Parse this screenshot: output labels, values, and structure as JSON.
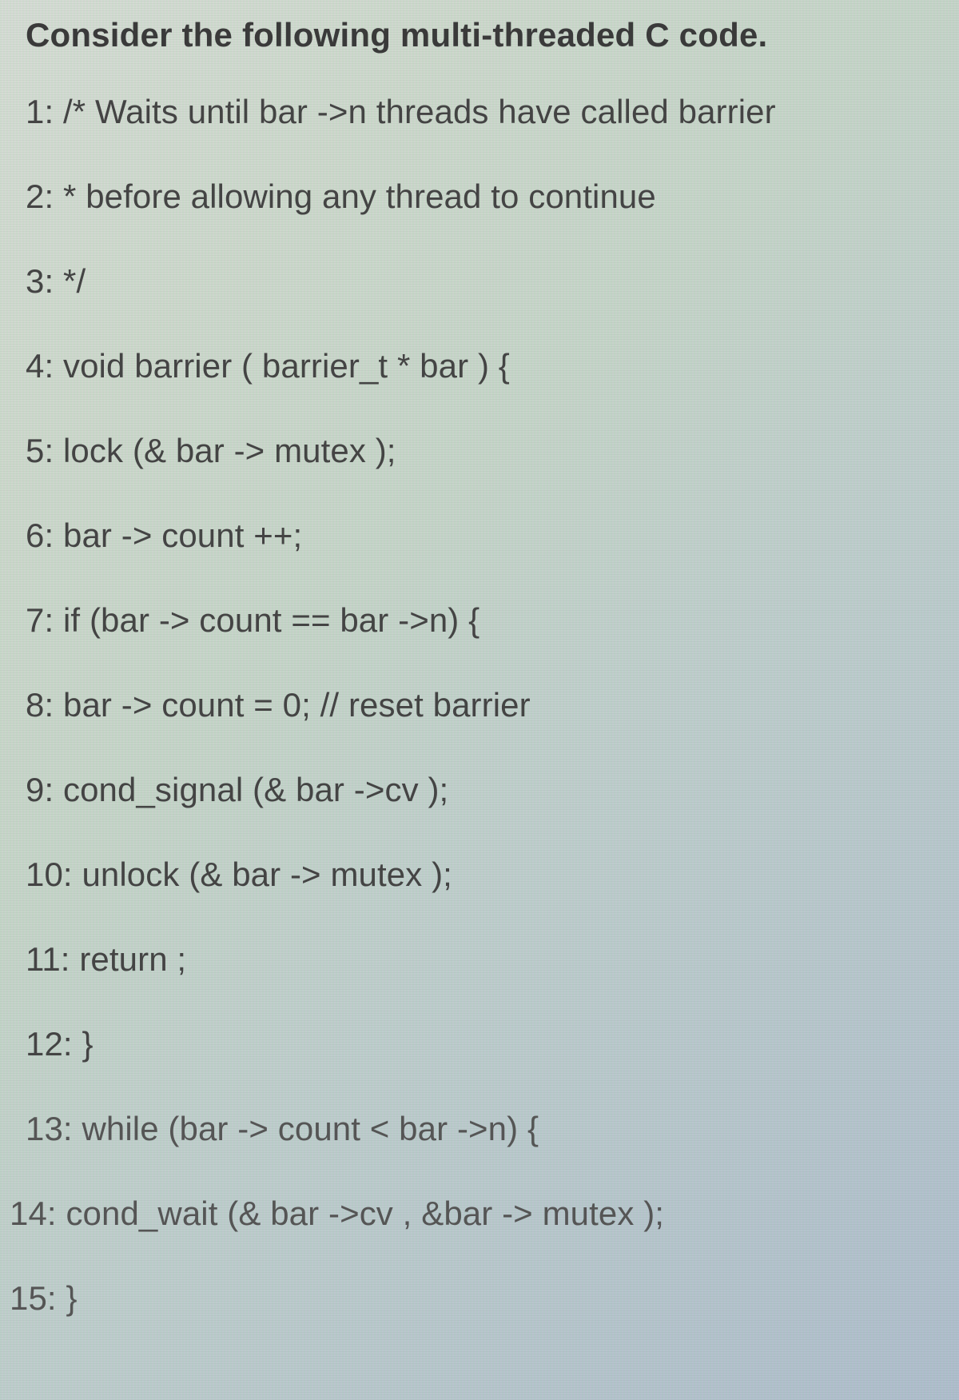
{
  "intro": "Consider the following multi-threaded C code.",
  "lines": {
    "l1": "1: /* Waits until bar ->n threads have called barrier",
    "l2": "2: * before allowing any thread to continue",
    "l3": "3: */",
    "l4": "4: void barrier ( barrier_t * bar ) {",
    "l5": "5: lock (& bar -> mutex );",
    "l6": "6: bar -> count ++;",
    "l7": "7: if (bar -> count == bar ->n) {",
    "l8": "8: bar -> count = 0; // reset barrier",
    "l9": "9: cond_signal (& bar ->cv );",
    "l10": "10: unlock (& bar -> mutex );",
    "l11": "11: return ;",
    "l12": "12: }",
    "l13": "13: while (bar -> count < bar ->n) {",
    "l14": "14: cond_wait (& bar ->cv , &bar -> mutex );",
    "l15": "15: }"
  }
}
